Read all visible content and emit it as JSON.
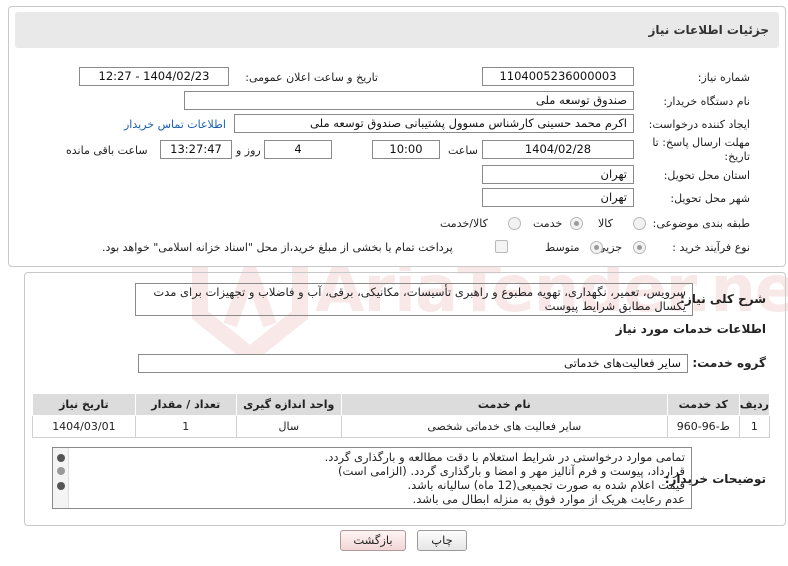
{
  "header": {
    "title": "جزئیات اطلاعات نیاز"
  },
  "fields": {
    "need_number_label": "شماره نیاز:",
    "need_number": "1104005236000003",
    "announce_label": "تاریخ و ساعت اعلان عمومی:",
    "announce_value": "1404/02/23 - 12:27",
    "buyer_org_label": "نام دستگاه خریدار:",
    "buyer_org": "صندوق توسعه ملی",
    "requester_label": "ایجاد کننده درخواست:",
    "requester": "اکرم محمد حسینی کارشناس مسوول پشتیبانی صندوق توسعه ملی",
    "contact_link": "اطلاعات تماس خریدار",
    "deadline_label_line1": "مهلت ارسال پاسخ: تا",
    "deadline_label_line2": "تاریخ:",
    "deadline_date": "1404/02/28",
    "hour_label": "ساعت",
    "deadline_time": "10:00",
    "days_value": "4",
    "days_label": "روز و",
    "remaining_time": "13:27:47",
    "remaining_label": "ساعت باقی مانده",
    "province_label": "استان محل تحویل:",
    "province": "تهران",
    "city_label": "شهر محل تحویل:",
    "city": "تهران",
    "category_label": "طبقه بندی موضوعی:",
    "category_options": [
      "کالا",
      "خدمت",
      "کالا/خدمت"
    ],
    "category_selected": "خدمت",
    "process_label": "نوع فرآیند خرید :",
    "process_options": [
      "جزیی",
      "متوسط"
    ],
    "process_selected": "جزیی",
    "treasury_note": "پرداخت تمام یا بخشی از مبلغ خرید،از محل \"اسناد خزانه اسلامی\" خواهد بود."
  },
  "description": {
    "label": "شرح کلی نیاز:",
    "text": "سرویس، تعمیر، نگهداری، تهویه مطبوع و راهبری تأسیسات، مکانیکی، برقی، آب و فاضلاب و تجهیزات برای مدت یکسال مطابق شرایط پیوست"
  },
  "services": {
    "section_title": "اطلاعات خدمات مورد نیاز",
    "group_label": "گروه خدمت:",
    "group_value": "سایر فعالیت‌های خدماتی",
    "columns": [
      "ردیف",
      "کد خدمت",
      "نام خدمت",
      "واحد اندازه گیری",
      "تعداد / مقدار",
      "تاریخ نیاز"
    ],
    "rows": [
      [
        "1",
        "ط-96-960",
        "سایر فعالیت های خدماتی شخصی",
        "سال",
        "1",
        "1404/03/01"
      ]
    ]
  },
  "buyer_notes": {
    "label": "توضیحات خریدار:",
    "lines": [
      "تمامی موارد درخواستی در شرایط استعلام با دقت مطالعه و بارگذاری گردد.",
      "قرارداد، پیوست و فرم آنالیز مهر و امضا و بارگذاری گردد. (الزامی است)",
      "قیمت اعلام شده به صورت تجمیعی(12 ماه) سالیانه باشد.",
      "عدم رعایت هریک از موارد فوق به منزله ابطال می باشد."
    ]
  },
  "buttons": {
    "print": "چاپ",
    "back": "بازگشت"
  },
  "watermark": "AriaTender.net",
  "colors": {
    "header_bg": "#e9e9e9",
    "link": "#1a5fb4",
    "table_header": "#dcdcdc",
    "watermark": "#cd5050"
  }
}
